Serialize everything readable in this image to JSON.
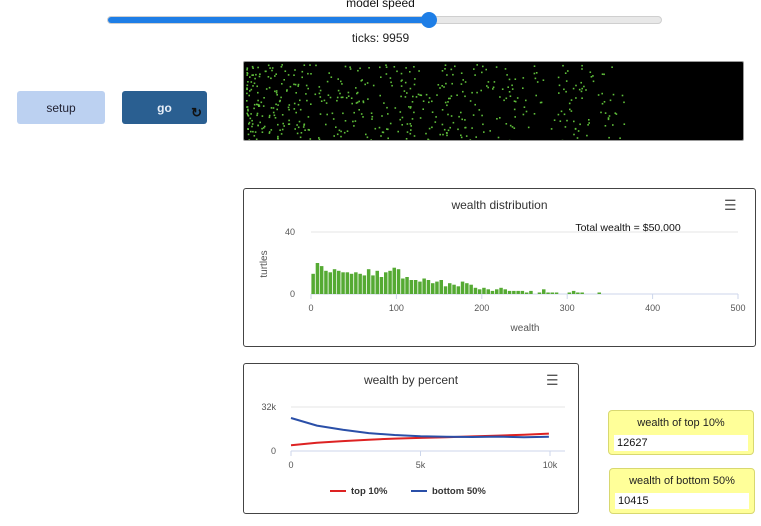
{
  "speed": {
    "label": "model speed",
    "value_fraction": 0.58
  },
  "ticks_text": "ticks: 9959",
  "buttons": {
    "setup": "setup",
    "go": "go",
    "go_forever_icon": "refresh-icon"
  },
  "world": {
    "background": "#000000",
    "turtle_color": "#5fbf3a"
  },
  "chart_data": [
    {
      "type": "bar",
      "title": "wealth distribution",
      "xlabel": "wealth",
      "ylabel": "turtles",
      "annotation": "Total wealth = $50,000",
      "xlim": [
        0,
        500
      ],
      "ylim": [
        0,
        40
      ],
      "xticks": [
        "0",
        "100",
        "200",
        "300",
        "400",
        "500"
      ],
      "yticks": [
        "0",
        "40"
      ],
      "bin_width": 5,
      "color": "#55aa33",
      "values": [
        13,
        20,
        18,
        15,
        14,
        16,
        15,
        14,
        14,
        13,
        14,
        13,
        12,
        16,
        12,
        15,
        11,
        14,
        15,
        17,
        16,
        10,
        11,
        9,
        9,
        8,
        10,
        9,
        7,
        8,
        9,
        5,
        7,
        6,
        5,
        8,
        7,
        6,
        4,
        3,
        4,
        3,
        2,
        3,
        4,
        3,
        2,
        2,
        2,
        2,
        1,
        2,
        0,
        1,
        3,
        1,
        1,
        1,
        0,
        0,
        1,
        2,
        1,
        1,
        0,
        0,
        0,
        1,
        0,
        0,
        0,
        0,
        0,
        0,
        0,
        0,
        0,
        0,
        0,
        0,
        0,
        0,
        0,
        0,
        0,
        0,
        0,
        0,
        0,
        0,
        0,
        0,
        0,
        0,
        0,
        0,
        0,
        0,
        0,
        0
      ]
    },
    {
      "type": "line",
      "title": "wealth by percent",
      "xlim": [
        0,
        10000
      ],
      "ylim": [
        0,
        32000
      ],
      "xticks": [
        "0",
        "5k",
        "10k"
      ],
      "yticks": [
        "0",
        "32k"
      ],
      "series": [
        {
          "name": "top 10%",
          "color": "#dd2222",
          "x": [
            0,
            1000,
            2000,
            3000,
            4000,
            5000,
            6000,
            7000,
            8000,
            9000,
            9959
          ],
          "y": [
            4200,
            6000,
            7200,
            8200,
            9000,
            9500,
            10000,
            10600,
            11200,
            11800,
            12627
          ]
        },
        {
          "name": "bottom 50%",
          "color": "#2a4fa8",
          "x": [
            0,
            1000,
            2000,
            3000,
            4000,
            5000,
            6000,
            7000,
            8000,
            9000,
            9959
          ],
          "y": [
            24000,
            18500,
            15500,
            13000,
            11600,
            10800,
            10400,
            10200,
            10500,
            10000,
            10415
          ]
        }
      ]
    }
  ],
  "monitors": {
    "top10": {
      "label": "wealth of top 10%",
      "value": "12627"
    },
    "bottom50": {
      "label": "wealth of bottom 50%",
      "value": "10415"
    }
  }
}
